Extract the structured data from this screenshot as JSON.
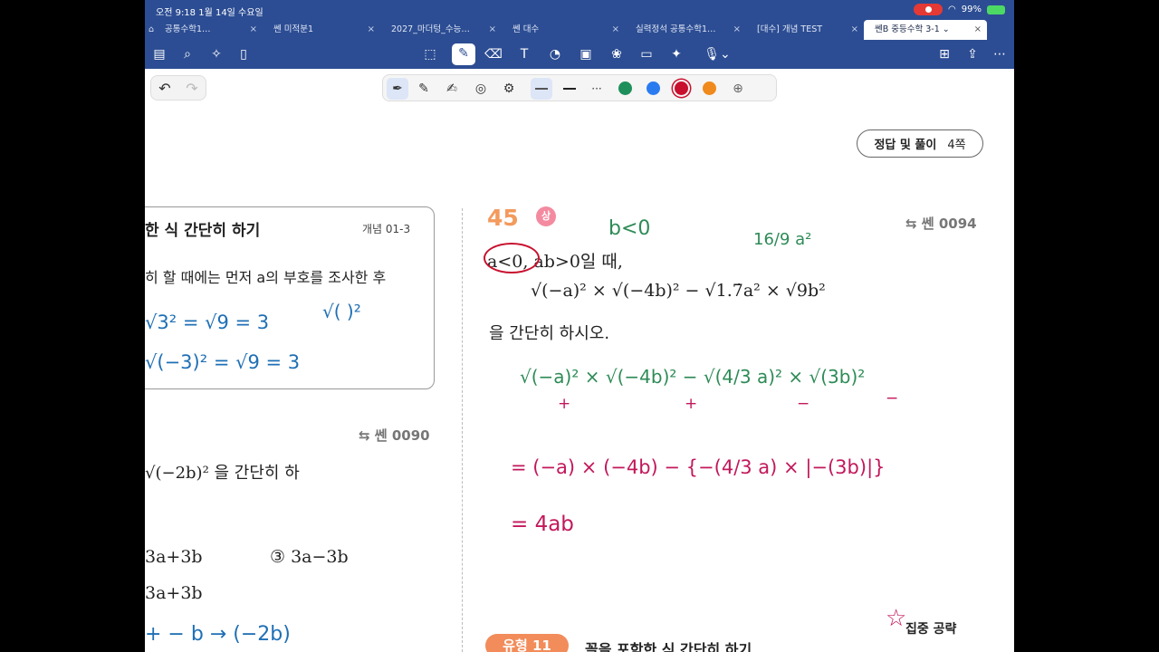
{
  "status": {
    "time": "오전 9:18   1월 14일 수요일",
    "battery": "99%"
  },
  "tabs": [
    {
      "label": "공통수학1…",
      "active": false
    },
    {
      "label": "쎈 미적분1",
      "active": false
    },
    {
      "label": "2027_마더텅_수능…",
      "active": false
    },
    {
      "label": "쎈 대수",
      "active": false
    },
    {
      "label": "실력정석 공통수학1…",
      "active": false
    },
    {
      "label": "[대수] 개념 TEST",
      "active": false
    },
    {
      "label": "쎈B 중등수학 3-1 ⌄",
      "active": true
    }
  ],
  "colors": {
    "accent": "#2c4d93",
    "green": "#1e8f5a",
    "blue": "#2b7bf0",
    "red": "#c8102e",
    "orange": "#f08a1c"
  },
  "page": {
    "answer_label": "정답 및 풀이",
    "answer_page": "4쪽",
    "concept_title": "한 식 간단히 하기",
    "concept_tag": "개념 01-3",
    "concept_text": "히 할 때에는 먼저 a의 부호를 조사한 후",
    "sen_0090": "쎈 0090",
    "left_problem": "√(−2b)² 을 간단히 하",
    "left_choice_a": "3a+3b",
    "left_choice_3": "③  3a−3b",
    "left_choice_b": "3a+3b",
    "problem_number": "45",
    "difficulty": "상",
    "sen_0094": "쎈 0094",
    "condition": "a<0, ab>0일 때,",
    "expression": "√(−a)² × √(−4b)² − √1.7̇a² × √9b²",
    "instruction": "을 간단히 하시오.",
    "type_label": "유형 11",
    "type_title": "꼴을 포함한 식 간단히 하기",
    "focus_label": "집중 공략"
  },
  "handwriting": {
    "note_b": "b<0",
    "note_frac": "16/9 a²",
    "concept_line1": "√3² = √9 = 3",
    "concept_line2": "√(−3)² = √9 = 3",
    "concept_side": "√( )²",
    "rewrite": "√(−a)² × √(−4b)² − √(4/3 a)² × √(3b)²",
    "signs": [
      "+",
      "+",
      "−",
      "−"
    ],
    "step1": "= (−a) × (−4b) − {−(4/3 a) × |−(3b)|}",
    "step2": "= 4ab",
    "left_work": "+ − b → (−2b)"
  }
}
